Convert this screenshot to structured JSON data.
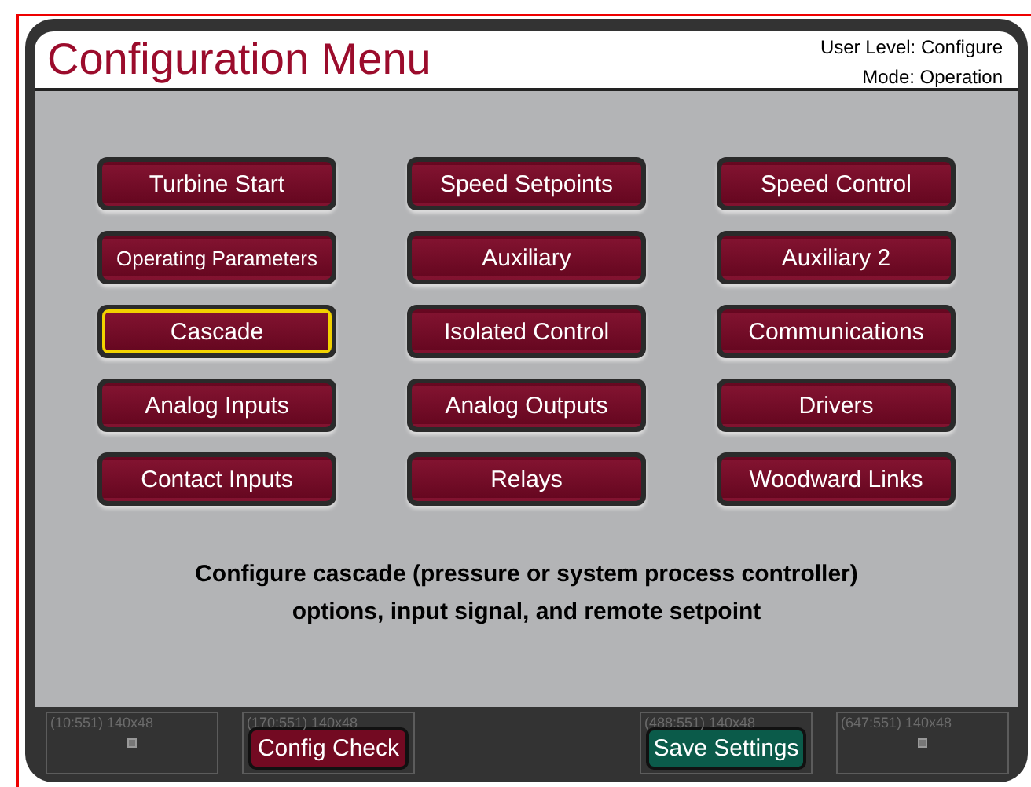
{
  "header": {
    "title": "Configuration Menu",
    "user_level": "User Level: Configure",
    "mode": "Mode: Operation"
  },
  "menu": [
    {
      "label": "Turbine Start",
      "selected": false
    },
    {
      "label": "Speed Setpoints",
      "selected": false
    },
    {
      "label": "Speed Control",
      "selected": false
    },
    {
      "label": "Operating Parameters",
      "selected": false
    },
    {
      "label": "Auxiliary",
      "selected": false
    },
    {
      "label": "Auxiliary 2",
      "selected": false
    },
    {
      "label": "Cascade",
      "selected": true
    },
    {
      "label": "Isolated Control",
      "selected": false
    },
    {
      "label": "Communications",
      "selected": false
    },
    {
      "label": "Analog Inputs",
      "selected": false
    },
    {
      "label": "Analog Outputs",
      "selected": false
    },
    {
      "label": "Drivers",
      "selected": false
    },
    {
      "label": "Contact Inputs",
      "selected": false
    },
    {
      "label": "Relays",
      "selected": false
    },
    {
      "label": "Woodward Links",
      "selected": false
    }
  ],
  "description": "Configure cascade (pressure or system process controller) options, input signal, and remote setpoint",
  "footer": [
    {
      "slot_label": "(10:551) 140x48",
      "kind": "empty"
    },
    {
      "slot_label": "(170:551) 140x48",
      "kind": "button",
      "label": "Config Check",
      "color": "#730a22"
    },
    {
      "slot_label": "(488:551) 140x48",
      "kind": "button",
      "label": "Save Settings",
      "color": "#0b5b4a"
    },
    {
      "slot_label": "(647:551) 140x48",
      "kind": "empty"
    }
  ]
}
